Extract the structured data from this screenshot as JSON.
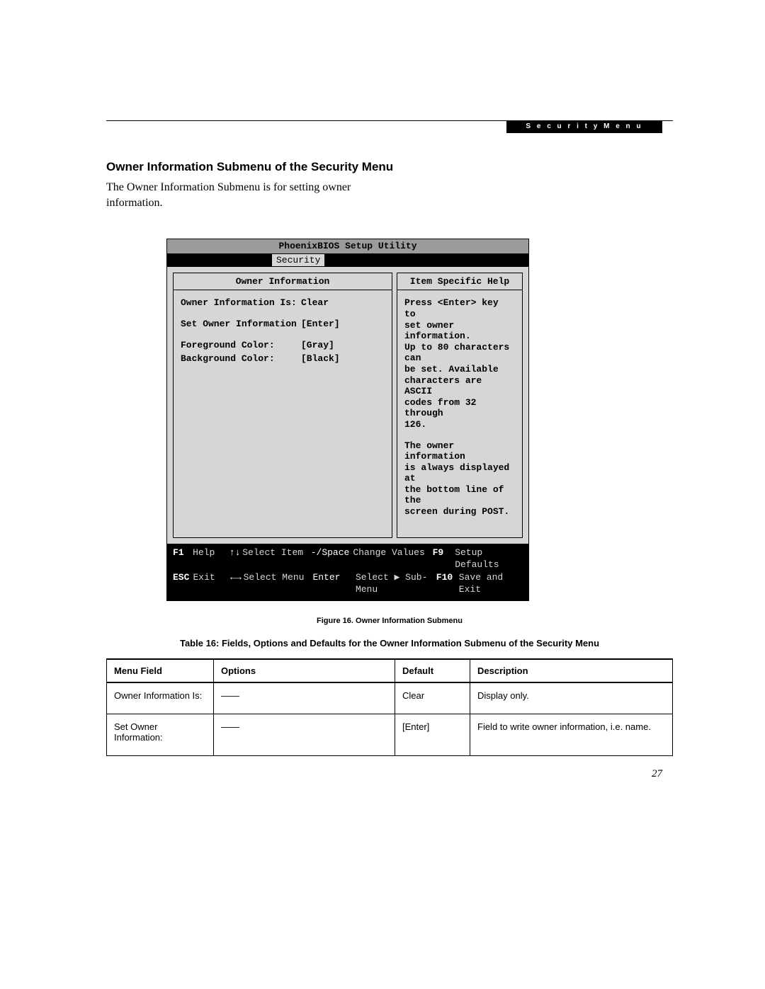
{
  "header_tag": "S e c u r i t y   M e n u",
  "section_title": "Owner Information Submenu of the Security Menu",
  "intro": "The Owner Information Submenu is for setting owner information.",
  "bios": {
    "title": "PhoenixBIOS Setup Utility",
    "tab": "Security",
    "left_heading": "Owner Information",
    "right_heading": "Item Specific Help",
    "rows": [
      {
        "label": "Owner Information Is:",
        "value": "Clear"
      },
      {
        "label": "Set Owner Information",
        "value": "[Enter]"
      },
      {
        "label": "Foreground Color:",
        "value": "[Gray]"
      },
      {
        "label": "Background Color:",
        "value": "[Black]"
      }
    ],
    "help1": "Press <Enter> key to\nset owner information.\nUp to 80 characters can\nbe set. Available\ncharacters are ASCII\ncodes from 32 through\n126.",
    "help2": "The owner information\nis always displayed at\nthe bottom line of the\nscreen during POST.",
    "footer": {
      "r1": {
        "k1": "F1",
        "a1": "Help",
        "s1": "↑↓",
        "l1": "Select Item",
        "s2": "-/Space",
        "l2": "Change Values",
        "k2": "F9",
        "a2": "Setup Defaults"
      },
      "r2": {
        "k1": "ESC",
        "a1": "Exit",
        "s1": "←→",
        "l1": "Select Menu",
        "s2": "Enter",
        "l2": "Select ▶ Sub-Menu",
        "k2": "F10",
        "a2": "Save and Exit"
      }
    }
  },
  "figure_caption": "Figure 16. Owner Information Submenu",
  "table_caption": "Table 16: Fields, Options and Defaults for the Owner Information Submenu of the Security Menu",
  "table": {
    "headers": {
      "c1": "Menu Field",
      "c2": "Options",
      "c3": "Default",
      "c4": "Description"
    },
    "rows": [
      {
        "c1": "Owner Information Is:",
        "c2": "——",
        "c3": "Clear",
        "c4": "Display only."
      },
      {
        "c1": "Set Owner Information:",
        "c2": "——",
        "c3": "[Enter]",
        "c4": "Field to write owner information, i.e. name."
      }
    ]
  },
  "page_number": "27"
}
